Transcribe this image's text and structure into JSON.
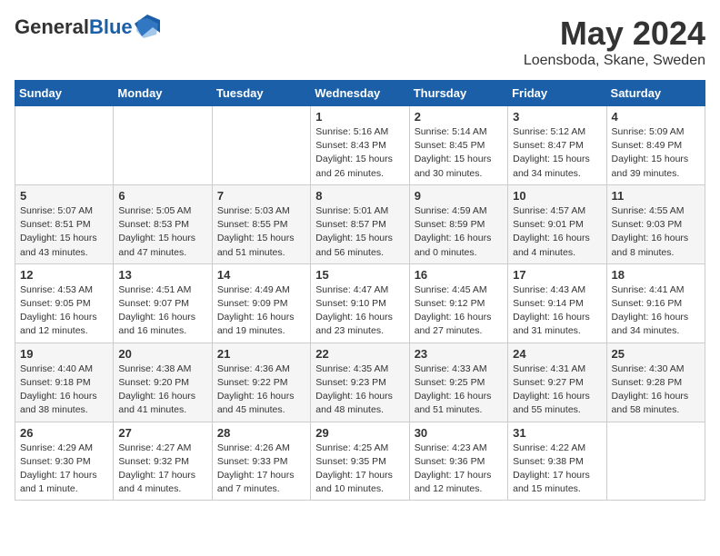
{
  "header": {
    "logo_general": "General",
    "logo_blue": "Blue",
    "month": "May 2024",
    "location": "Loensboda, Skane, Sweden"
  },
  "weekdays": [
    "Sunday",
    "Monday",
    "Tuesday",
    "Wednesday",
    "Thursday",
    "Friday",
    "Saturday"
  ],
  "weeks": [
    [
      {
        "day": "",
        "info": ""
      },
      {
        "day": "",
        "info": ""
      },
      {
        "day": "",
        "info": ""
      },
      {
        "day": "1",
        "info": "Sunrise: 5:16 AM\nSunset: 8:43 PM\nDaylight: 15 hours\nand 26 minutes."
      },
      {
        "day": "2",
        "info": "Sunrise: 5:14 AM\nSunset: 8:45 PM\nDaylight: 15 hours\nand 30 minutes."
      },
      {
        "day": "3",
        "info": "Sunrise: 5:12 AM\nSunset: 8:47 PM\nDaylight: 15 hours\nand 34 minutes."
      },
      {
        "day": "4",
        "info": "Sunrise: 5:09 AM\nSunset: 8:49 PM\nDaylight: 15 hours\nand 39 minutes."
      }
    ],
    [
      {
        "day": "5",
        "info": "Sunrise: 5:07 AM\nSunset: 8:51 PM\nDaylight: 15 hours\nand 43 minutes."
      },
      {
        "day": "6",
        "info": "Sunrise: 5:05 AM\nSunset: 8:53 PM\nDaylight: 15 hours\nand 47 minutes."
      },
      {
        "day": "7",
        "info": "Sunrise: 5:03 AM\nSunset: 8:55 PM\nDaylight: 15 hours\nand 51 minutes."
      },
      {
        "day": "8",
        "info": "Sunrise: 5:01 AM\nSunset: 8:57 PM\nDaylight: 15 hours\nand 56 minutes."
      },
      {
        "day": "9",
        "info": "Sunrise: 4:59 AM\nSunset: 8:59 PM\nDaylight: 16 hours\nand 0 minutes."
      },
      {
        "day": "10",
        "info": "Sunrise: 4:57 AM\nSunset: 9:01 PM\nDaylight: 16 hours\nand 4 minutes."
      },
      {
        "day": "11",
        "info": "Sunrise: 4:55 AM\nSunset: 9:03 PM\nDaylight: 16 hours\nand 8 minutes."
      }
    ],
    [
      {
        "day": "12",
        "info": "Sunrise: 4:53 AM\nSunset: 9:05 PM\nDaylight: 16 hours\nand 12 minutes."
      },
      {
        "day": "13",
        "info": "Sunrise: 4:51 AM\nSunset: 9:07 PM\nDaylight: 16 hours\nand 16 minutes."
      },
      {
        "day": "14",
        "info": "Sunrise: 4:49 AM\nSunset: 9:09 PM\nDaylight: 16 hours\nand 19 minutes."
      },
      {
        "day": "15",
        "info": "Sunrise: 4:47 AM\nSunset: 9:10 PM\nDaylight: 16 hours\nand 23 minutes."
      },
      {
        "day": "16",
        "info": "Sunrise: 4:45 AM\nSunset: 9:12 PM\nDaylight: 16 hours\nand 27 minutes."
      },
      {
        "day": "17",
        "info": "Sunrise: 4:43 AM\nSunset: 9:14 PM\nDaylight: 16 hours\nand 31 minutes."
      },
      {
        "day": "18",
        "info": "Sunrise: 4:41 AM\nSunset: 9:16 PM\nDaylight: 16 hours\nand 34 minutes."
      }
    ],
    [
      {
        "day": "19",
        "info": "Sunrise: 4:40 AM\nSunset: 9:18 PM\nDaylight: 16 hours\nand 38 minutes."
      },
      {
        "day": "20",
        "info": "Sunrise: 4:38 AM\nSunset: 9:20 PM\nDaylight: 16 hours\nand 41 minutes."
      },
      {
        "day": "21",
        "info": "Sunrise: 4:36 AM\nSunset: 9:22 PM\nDaylight: 16 hours\nand 45 minutes."
      },
      {
        "day": "22",
        "info": "Sunrise: 4:35 AM\nSunset: 9:23 PM\nDaylight: 16 hours\nand 48 minutes."
      },
      {
        "day": "23",
        "info": "Sunrise: 4:33 AM\nSunset: 9:25 PM\nDaylight: 16 hours\nand 51 minutes."
      },
      {
        "day": "24",
        "info": "Sunrise: 4:31 AM\nSunset: 9:27 PM\nDaylight: 16 hours\nand 55 minutes."
      },
      {
        "day": "25",
        "info": "Sunrise: 4:30 AM\nSunset: 9:28 PM\nDaylight: 16 hours\nand 58 minutes."
      }
    ],
    [
      {
        "day": "26",
        "info": "Sunrise: 4:29 AM\nSunset: 9:30 PM\nDaylight: 17 hours\nand 1 minute."
      },
      {
        "day": "27",
        "info": "Sunrise: 4:27 AM\nSunset: 9:32 PM\nDaylight: 17 hours\nand 4 minutes."
      },
      {
        "day": "28",
        "info": "Sunrise: 4:26 AM\nSunset: 9:33 PM\nDaylight: 17 hours\nand 7 minutes."
      },
      {
        "day": "29",
        "info": "Sunrise: 4:25 AM\nSunset: 9:35 PM\nDaylight: 17 hours\nand 10 minutes."
      },
      {
        "day": "30",
        "info": "Sunrise: 4:23 AM\nSunset: 9:36 PM\nDaylight: 17 hours\nand 12 minutes."
      },
      {
        "day": "31",
        "info": "Sunrise: 4:22 AM\nSunset: 9:38 PM\nDaylight: 17 hours\nand 15 minutes."
      },
      {
        "day": "",
        "info": ""
      }
    ]
  ]
}
